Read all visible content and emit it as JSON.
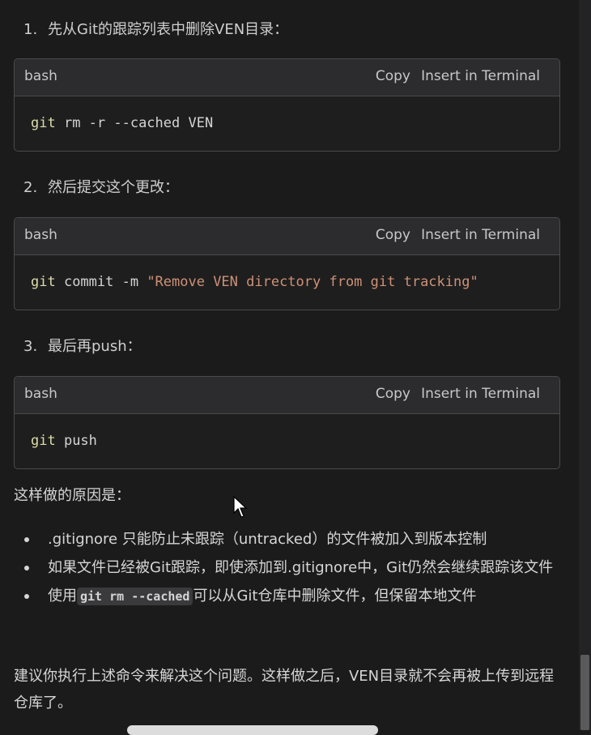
{
  "steps": [
    {
      "num": "1.",
      "text": "先从Git的跟踪列表中删除VEN目录："
    },
    {
      "num": "2.",
      "text": "然后提交这个更改："
    },
    {
      "num": "3.",
      "text": "最后再push："
    }
  ],
  "code_blocks": [
    {
      "lang": "bash",
      "copy": "Copy",
      "insert": "Insert in Terminal",
      "cmd": "git",
      "args": " rm -r --cached VEN",
      "str": ""
    },
    {
      "lang": "bash",
      "copy": "Copy",
      "insert": "Insert in Terminal",
      "cmd": "git",
      "args": " commit -m ",
      "str": "\"Remove VEN directory from git tracking\""
    },
    {
      "lang": "bash",
      "copy": "Copy",
      "insert": "Insert in Terminal",
      "cmd": "git",
      "args": " push",
      "str": ""
    }
  ],
  "reason_heading": "这样做的原因是：",
  "bullets": {
    "b1": ".gitignore 只能防止未跟踪（untracked）的文件被加入到版本控制",
    "b2": "如果文件已经被Git跟踪，即使添加到.gitignore中，Git仍然会继续跟踪该文件",
    "b3_pre": "使用",
    "b3_code": "git rm --cached",
    "b3_post": "可以从Git仓库中删除文件，但保留本地文件"
  },
  "final_text": "建议你执行上述命令来解决这个问题。这样做之后，VEN目录就不会再被上传到远程仓库了。",
  "colors": {
    "background": "#1b1b1c",
    "code_header": "#2c2c2e",
    "command": "#dcdcaa",
    "string": "#ce9178"
  }
}
